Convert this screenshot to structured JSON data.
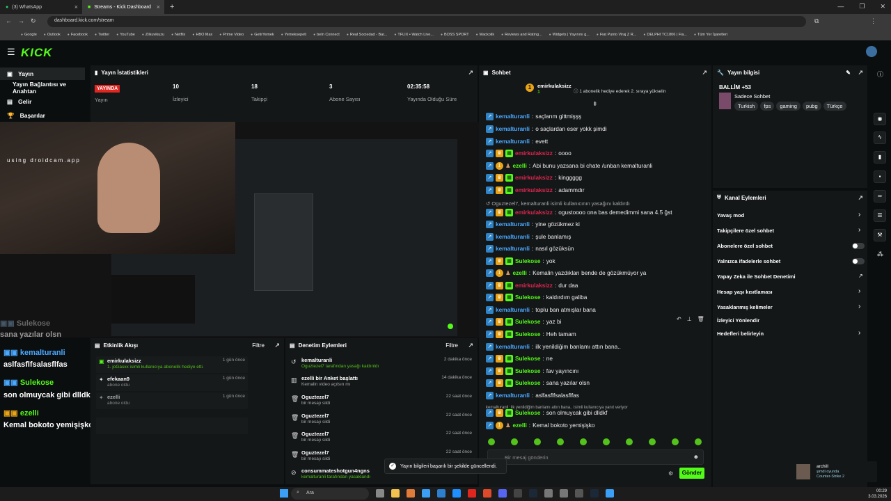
{
  "browser": {
    "tabs": [
      {
        "title": "(3) WhatsApp",
        "active": false
      },
      {
        "title": "Streams - Kick Dashboard",
        "active": true
      }
    ],
    "url": "dashboard.kick.com/stream",
    "bookmarks": [
      "Google",
      "Outlook",
      "Facebook",
      "Twitter",
      "YouTube",
      "Zilkuvikuzu",
      "Netflix",
      "HBO Max",
      "Prime Video",
      "GetirYemek",
      "Yemeksepeti",
      "beIn Connect",
      "Real Sociedad - Bar...",
      "TFLIX • Watch Live...",
      "BOSS SPORT",
      "Mackolik",
      "Reviews and Rating...",
      "Widgets | Yayınını g...",
      "Fiat Punto Viraj Z R...",
      "DELPHI TC1806 | Fia...",
      "Tüm Yer İşaretleri"
    ]
  },
  "header": {
    "logo": "KICK"
  },
  "sidebar": {
    "items": [
      {
        "label": "Yayın",
        "selected": true
      },
      {
        "label": "Yayın Bağlantısı ve Anahtarı",
        "selected": false
      },
      {
        "label": "Gelir",
        "selected": false
      },
      {
        "label": "Başarılar",
        "selected": false
      }
    ]
  },
  "stats": {
    "title": "Yayın İstatistikleri",
    "items": [
      {
        "value": "YAYINDA",
        "label": "Yayın"
      },
      {
        "value": "10",
        "label": "İzleyici"
      },
      {
        "value": "18",
        "label": "Takipçi"
      },
      {
        "value": "3",
        "label": "Abone Sayısı"
      },
      {
        "value": "02:35:58",
        "label": "Yayında Olduğu Süre"
      }
    ]
  },
  "video": {
    "cam_text": "using droidcam.app",
    "overlay": [
      {
        "user": "Sulekose",
        "msg": "sana yazılar olsn"
      },
      {
        "user": "kemalturanli",
        "msg": "aslfasflfsalasflfas"
      },
      {
        "user": "Sulekose",
        "msg": "son olmuycak gibi dlldkf"
      },
      {
        "user": "ezelli",
        "msg": "Kemal bokoto yemişişko"
      }
    ]
  },
  "activity": {
    "title": "Etkinlik Akışı",
    "filter": "Filtre",
    "items": [
      {
        "title": "emirkulaksizz",
        "sub": "1. joGasxx isimli kullanıcıya abonelik hediye etti.",
        "time": "1 gün önce"
      },
      {
        "title": "efekaan9",
        "sub": "abone oldu",
        "time": "1 gün önce"
      },
      {
        "title": "ezelli",
        "sub": "abone oldu",
        "time": "1 gün önce"
      }
    ]
  },
  "moderation": {
    "title": "Denetim Eylemleri",
    "filter": "Filtre",
    "items": [
      {
        "title": "kemalturanli",
        "sub": "Oguztezel7 tarafından yasağı kaldırıldı",
        "time": "2 dakika önce"
      },
      {
        "title": "ezelli bir Anket başlattı",
        "sub": "Kemalin video açılsın mı",
        "time": "14 dakika önce"
      },
      {
        "title": "Oguztezel7",
        "sub": "bir mesajı sildi",
        "time": "22 saat önce"
      },
      {
        "title": "Oguztezel7",
        "sub": "bir mesajı sildi",
        "time": "22 saat önce"
      },
      {
        "title": "Oguztezel7",
        "sub": "bir mesajı sildi",
        "time": "22 saat önce"
      },
      {
        "title": "Oguztezel7",
        "sub": "bir mesajı sildi",
        "time": "22 saat önce"
      },
      {
        "title": "consummateshotgun4ngns",
        "sub": "kemalturanli tarafından yasaklandı",
        "time": ""
      }
    ]
  },
  "chat": {
    "title": "Sohbet",
    "pinned_user": "emirkulaksizz",
    "pinned_count": "1",
    "pinned_note": "1 abonelik hediye ederek 2. sıraya yükselin",
    "messages": [
      {
        "user": "kemalturanli",
        "color": "blue",
        "text": "saçlarım gittmişşş"
      },
      {
        "user": "kemalturanli",
        "color": "blue",
        "text": "o saçlardan eser yokk şimdi"
      },
      {
        "user": "kemalturanli",
        "color": "blue",
        "text": "evett"
      },
      {
        "user": "emirkulaksizz",
        "color": "red",
        "text": "oooo"
      },
      {
        "user": "ezelli",
        "color": "green",
        "text": "Abi bunu yazsana bi chate /unban kemalturanli"
      },
      {
        "user": "emirkulaksizz",
        "color": "red",
        "text": "kinggggg"
      },
      {
        "user": "emirkulaksizz",
        "color": "red",
        "text": "adammdır"
      },
      {
        "user": "emirkulaksizz",
        "color": "red",
        "text": "ogustoooo ona bas demedimmi sana 4.5 ğst"
      },
      {
        "user": "kemalturanli",
        "color": "blue",
        "text": "yine gözükmez ki"
      },
      {
        "user": "kemalturanli",
        "color": "blue",
        "text": "şule banlamış"
      },
      {
        "user": "kemalturanli",
        "color": "blue",
        "text": "nasıl gözüksün"
      },
      {
        "user": "Sulekose",
        "color": "green",
        "text": "yok"
      },
      {
        "user": "ezelli",
        "color": "green",
        "text": "Kemalin yazdıkları bende de gözükmüyor ya"
      },
      {
        "user": "emirkulaksizz",
        "color": "red",
        "text": "dur daa"
      },
      {
        "user": "Sulekose",
        "color": "green",
        "text": "kaldırdım galiba"
      },
      {
        "user": "kemalturanli",
        "color": "blue",
        "text": "toplu ban atmışlar bana"
      },
      {
        "user": "Sulekose",
        "color": "green",
        "text": "yaz bi"
      },
      {
        "user": "Sulekose",
        "color": "green",
        "text": "Heh tamam"
      },
      {
        "user": "kemalturanli",
        "color": "blue",
        "text": "ilk yenildiğim banlamı attın bana.."
      },
      {
        "user": "Sulekose",
        "color": "green",
        "text": "ne"
      },
      {
        "user": "Sulekose",
        "color": "green",
        "text": "fav yayıncını"
      },
      {
        "user": "Sulekose",
        "color": "green",
        "text": "sana yazılar olsn"
      },
      {
        "user": "kemalturanli",
        "color": "blue",
        "text": "aslfasflfsalasflfas"
      },
      {
        "user": "Sulekose",
        "color": "green",
        "text": "son olmuycak gibi dlldkf"
      },
      {
        "user": "ezelli",
        "color": "green",
        "text": "Kemal bokoto yemişişko"
      }
    ],
    "system_unban": "Oguztezel7, kemalturanli isimli kullanıcının yasağını kaldırdı",
    "reply_hint": "kemalturanli: ilk yenildiğim banlamı attın bana.. isimli kullanıcıya yanıt veriyor",
    "placeholder": "Bir mesaj gönderin",
    "send": "Gönder"
  },
  "stream_info": {
    "title": "Yayın bilgisi",
    "stream_title": "BALLİM +53",
    "category": "Sadece Sohbet",
    "tags": [
      "Turkish",
      "fps",
      "gaming",
      "pubg",
      "Türkçe"
    ]
  },
  "channel_actions": {
    "title": "Kanal Eylemleri",
    "items": [
      {
        "label": "Yavaş mod",
        "control": "chevron"
      },
      {
        "label": "Takipçilere özel sohbet",
        "control": "chevron"
      },
      {
        "label": "Abonelere özel sohbet",
        "control": "toggle"
      },
      {
        "label": "Yalnızca ifadelerle sohbet",
        "control": "toggle"
      },
      {
        "label": "Yapay Zeka ile Sohbet Denetimi",
        "control": "external"
      },
      {
        "label": "Hesap yaşı kısıtlaması",
        "control": "chevron"
      },
      {
        "label": "Yasaklanmış kelimeler",
        "control": "chevron"
      },
      {
        "label": "İzleyici Yönlendir",
        "control": "none"
      },
      {
        "label": "Hedefleri belirleyin",
        "control": "chevron"
      }
    ]
  },
  "toast": "Yayın bilgileri başarılı bir şekilde güncellendi.",
  "notification": {
    "user": "archill",
    "line1": "şimdi oyunda",
    "line2": "Counter-Strike 2"
  },
  "taskbar": {
    "search": "Ara",
    "time": "00:29",
    "date": "3.03.2026"
  },
  "colors": {
    "accent": "#53fc18",
    "live": "#e0261f",
    "blue_user": "#4aa8ff",
    "red_user": "#e0264f"
  }
}
